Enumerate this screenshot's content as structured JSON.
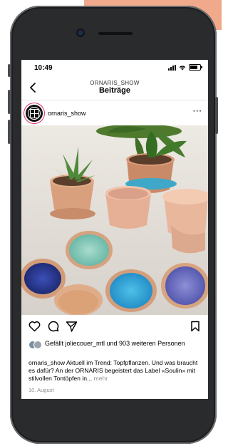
{
  "status_bar": {
    "time": "10:49"
  },
  "header": {
    "subtitle": "ORNARIS_SHOW",
    "title": "Beiträge"
  },
  "post": {
    "username": "ornaris_show",
    "more_menu": "···",
    "likes_text": "Gefällt joliecouer_mtl und 903 weiteren Personen",
    "caption_username": "ornaris_show",
    "caption_text": " Aktuell im Trend: Topfpflanzen. Und was braucht es dafür? An der ORNARIS begeistert das Label «Soulin» mit stilvollen Tontöpfen in...",
    "more_label": " mehr",
    "date": "10. August"
  },
  "icons": [
    "chevron-left-icon",
    "signal-icon",
    "wifi-icon",
    "battery-icon",
    "more-icon",
    "heart-icon",
    "comment-icon",
    "send-icon",
    "bookmark-icon"
  ],
  "colors": {
    "accent": "#f0a98a",
    "phone_body": "#2a2b2d",
    "story_ring": "#e1306c"
  }
}
